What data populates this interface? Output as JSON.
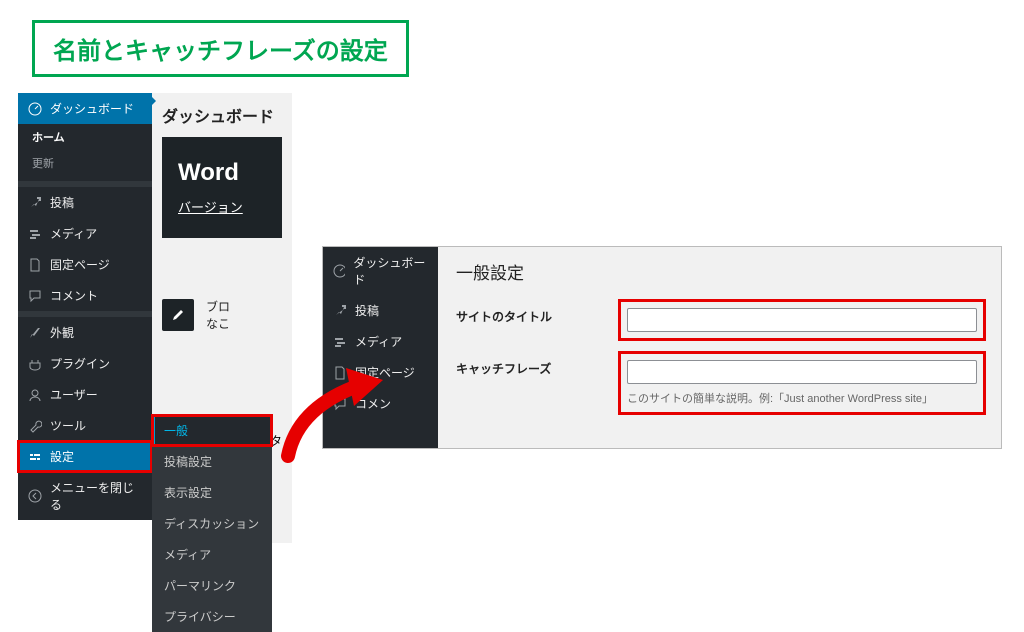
{
  "title": "名前とキャッチフレーズの設定",
  "sidebar1": {
    "dashboard": "ダッシュボード",
    "home": "ホーム",
    "update": "更新",
    "posts": "投稿",
    "media": "メディア",
    "pages": "固定ページ",
    "comments": "コメント",
    "appearance": "外観",
    "plugins": "プラグイン",
    "users": "ユーザー",
    "tools": "ツール",
    "settings": "設定",
    "collapse": "メニューを閉じる"
  },
  "submenu": {
    "general": "一般",
    "writing": "投稿設定",
    "reading": "表示設定",
    "discussion": "ディスカッション",
    "media": "メディア",
    "permalink": "パーマリンク",
    "privacy": "プライバシー"
  },
  "content1": {
    "heading": "ダッシュボード",
    "welcome_big": "Word",
    "welcome_sub": "バージョン",
    "edit_line1": "ブロ",
    "edit_line2": "なこ",
    "small": "タ"
  },
  "sidebar2": {
    "dashboard": "ダッシュボード",
    "posts": "投稿",
    "media": "メディア",
    "pages": "固定ページ",
    "comments": "コメン"
  },
  "settings": {
    "title": "一般設定",
    "site_title_label": "サイトのタイトル",
    "site_title_value": "",
    "tagline_label": "キャッチフレーズ",
    "tagline_value": "",
    "tagline_help": "このサイトの簡単な説明。例:「Just another WordPress site」"
  }
}
